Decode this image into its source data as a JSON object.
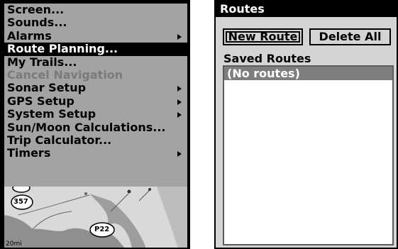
{
  "menu": {
    "items": [
      {
        "label": "Screen...",
        "submenu": false,
        "state": "normal"
      },
      {
        "label": "Sounds...",
        "submenu": false,
        "state": "normal"
      },
      {
        "label": "Alarms",
        "submenu": true,
        "state": "normal"
      },
      {
        "label": "Route Planning...",
        "submenu": false,
        "state": "selected"
      },
      {
        "label": "My Trails...",
        "submenu": false,
        "state": "normal"
      },
      {
        "label": "Cancel Navigation",
        "submenu": false,
        "state": "disabled"
      },
      {
        "label": "Sonar Setup",
        "submenu": true,
        "state": "normal"
      },
      {
        "label": "GPS Setup",
        "submenu": true,
        "state": "normal"
      },
      {
        "label": "System Setup",
        "submenu": true,
        "state": "normal"
      },
      {
        "label": "Sun/Moon Calculations...",
        "submenu": false,
        "state": "normal"
      },
      {
        "label": "Trip Calculator...",
        "submenu": false,
        "state": "normal"
      },
      {
        "label": "Timers",
        "submenu": true,
        "state": "normal"
      }
    ]
  },
  "map": {
    "markers": [
      "357",
      "P22"
    ],
    "scale_label": "20mi"
  },
  "routes": {
    "title": "Routes",
    "new_route_label": "New Route",
    "delete_all_label": "Delete All",
    "saved_label": "Saved Routes",
    "list_items": [
      "(No routes)"
    ]
  }
}
